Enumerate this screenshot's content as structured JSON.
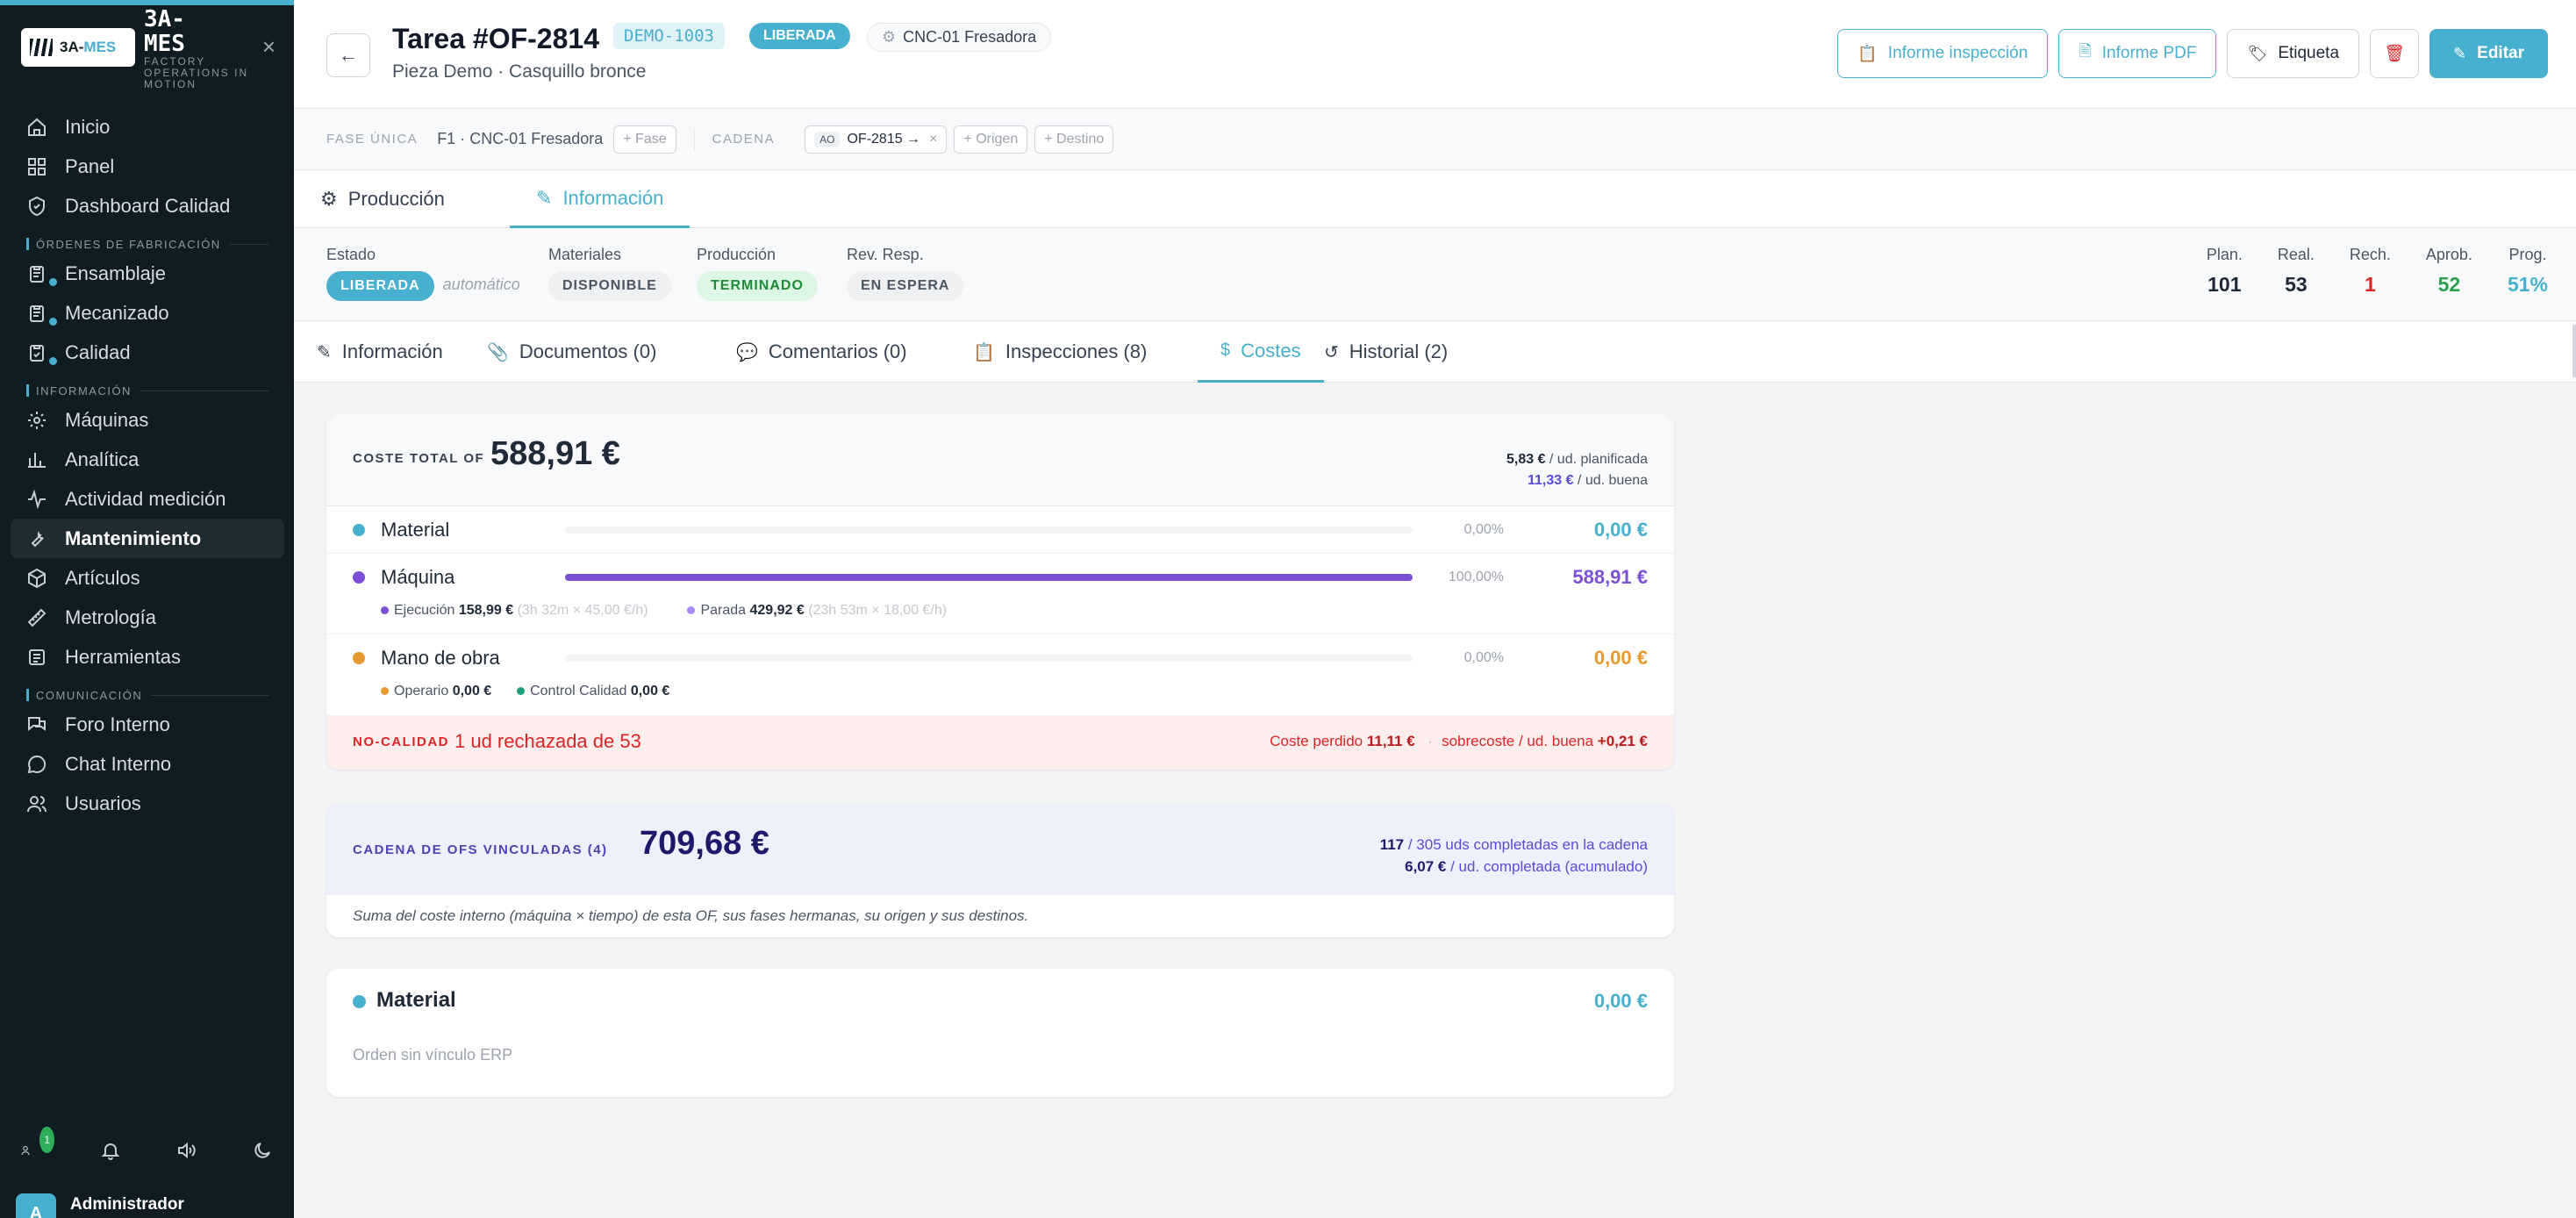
{
  "sidebar": {
    "logo_text": "3A-",
    "logo_accent": "MES",
    "brand_name": "3A-\nMES",
    "brand_tag": "FACTORY OPERATIONS IN MOTION",
    "items_top": [
      {
        "label": "Inicio",
        "icon": "home-icon"
      },
      {
        "label": "Panel",
        "icon": "grid-icon"
      },
      {
        "label": "Dashboard Calidad",
        "icon": "shield-icon"
      }
    ],
    "section_orders": "ÓRDENES DE FABRICACIÓN",
    "items_orders": [
      {
        "label": "Ensamblaje",
        "icon": "clipboard-icon"
      },
      {
        "label": "Mecanizado",
        "icon": "clipboard-icon"
      },
      {
        "label": "Calidad",
        "icon": "clipboard-check-icon"
      }
    ],
    "section_info": "INFORMACIÓN",
    "items_info": [
      {
        "label": "Máquinas",
        "icon": "cog-icon"
      },
      {
        "label": "Analítica",
        "icon": "bar-chart-icon"
      },
      {
        "label": "Actividad medición",
        "icon": "activity-icon"
      },
      {
        "label": "Mantenimiento",
        "icon": "wrench-icon"
      },
      {
        "label": "Artículos",
        "icon": "box-icon"
      },
      {
        "label": "Metrología",
        "icon": "ruler-icon"
      },
      {
        "label": "Herramientas",
        "icon": "tools-icon"
      }
    ],
    "section_comm": "COMUNICACIÓN",
    "items_comm": [
      {
        "label": "Foro Interno",
        "icon": "forum-icon"
      },
      {
        "label": "Chat Interno",
        "icon": "chat-icon"
      },
      {
        "label": "Usuarios",
        "icon": "users-icon"
      }
    ],
    "notif_count": "1",
    "user_initial": "A",
    "user_name": "Administrador"
  },
  "header": {
    "title": "Tarea #OF-2814",
    "code": "DEMO-1003",
    "status": "LIBERADA",
    "machine": "CNC-01 Fresadora",
    "subtitle": "Pieza Demo · Casquillo bronce",
    "btn_inspection": "Informe inspección",
    "btn_pdf": "Informe PDF",
    "btn_label": "Etiqueta",
    "btn_edit": "Editar"
  },
  "phasebar": {
    "phase_label": "FASE ÚNICA",
    "phase_value": "F1 · CNC-01 Fresadora",
    "add_phase": "+ Fase",
    "chain_label": "CADENA",
    "chain_ao": "AO",
    "chain_of": "OF-2815 →",
    "chain_x": "×",
    "add_origin": "+ Origen",
    "add_dest": "+ Destino"
  },
  "toptabs": {
    "production": "Producción",
    "information": "Información"
  },
  "status": {
    "estado_label": "Estado",
    "estado_value": "LIBERADA",
    "estado_auto": "automático",
    "materiales_label": "Materiales",
    "materiales_value": "DISPONIBLE",
    "produccion_label": "Producción",
    "produccion_value": "TERMINADO",
    "rev_label": "Rev. Resp.",
    "rev_value": "EN ESPERA",
    "kpis": [
      {
        "label": "Plan.",
        "value": "101",
        "color": "#1f2937"
      },
      {
        "label": "Real.",
        "value": "53",
        "color": "#1f2937"
      },
      {
        "label": "Rech.",
        "value": "1",
        "color": "#dc2626"
      },
      {
        "label": "Aprob.",
        "value": "52",
        "color": "#2fa04d"
      },
      {
        "label": "Prog.",
        "value": "51%",
        "color": "#48b0cf"
      }
    ]
  },
  "subtabs": {
    "info": "Información",
    "docs": "Documentos (0)",
    "comments": "Comentarios (0)",
    "inspections": "Inspecciones (8)",
    "costs": "Costes",
    "history": "Historial (2)"
  },
  "cost": {
    "label": "COSTE TOTAL OF",
    "total": "588,91 €",
    "per_planned_value": "5,83 €",
    "per_planned_label": " / ud. planificada",
    "per_good_value": "11,33 €",
    "per_good_label": " / ud. buena",
    "rows": {
      "material": {
        "name": "Material",
        "pct": "0,00%",
        "amount": "0,00 €",
        "color": "#48b0cf",
        "fraction": 0
      },
      "machine": {
        "name": "Máquina",
        "pct": "100,00%",
        "amount": "588,91 €",
        "color": "#7b4fd6",
        "fraction": 1
      },
      "labor": {
        "name": "Mano de obra",
        "pct": "0,00%",
        "amount": "0,00 €",
        "color": "#e69a2e",
        "fraction": 0
      }
    },
    "machine_exec_label": "Ejecución",
    "machine_exec_value": "158,99 €",
    "machine_exec_detail": "(3h 32m × 45,00 €/h)",
    "machine_stop_label": "Parada",
    "machine_stop_value": "429,92 €",
    "machine_stop_detail": "(23h 53m × 18,00 €/h)",
    "labor_op_label": "Operario",
    "labor_op_value": "0,00 €",
    "labor_qc_label": "Control Calidad",
    "labor_qc_value": "0,00 €",
    "nq_label": "NO-CALIDAD",
    "nq_text": "1 ud rechazada de 53",
    "nq_lost_label": "Coste perdido",
    "nq_lost_value": "11,11 €",
    "nq_sep": "·",
    "nq_over_label": "sobrecoste / ud. buena",
    "nq_over_value": "+0,21 €"
  },
  "chain": {
    "label": "CADENA DE OFS VINCULADAS (4)",
    "total": "709,68 €",
    "completed_value": "117",
    "completed_label": " / 305 uds completadas en la cadena",
    "per_unit_value": "6,07 €",
    "per_unit_label": " / ud. completada (acumulado)",
    "note": "Suma del coste interno (máquina × tiempo) de esta OF, sus fases hermanas, su origen y sus destinos."
  },
  "material_card": {
    "title": "Material",
    "amount": "0,00 €",
    "note": "Orden sin vínculo ERP"
  }
}
